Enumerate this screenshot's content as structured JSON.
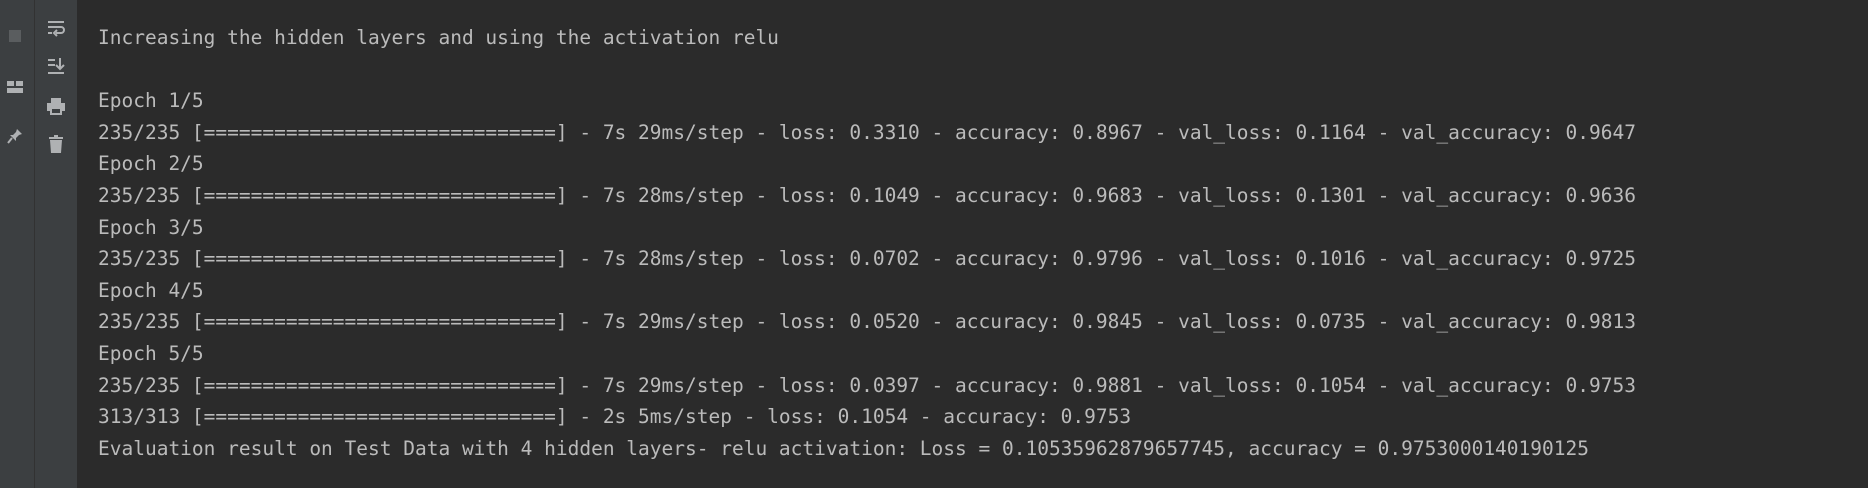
{
  "console": {
    "lines": [
      "Increasing the hidden layers and using the activation relu",
      "",
      "Epoch 1/5",
      "235/235 [==============================] - 7s 29ms/step - loss: 0.3310 - accuracy: 0.8967 - val_loss: 0.1164 - val_accuracy: 0.9647",
      "Epoch 2/5",
      "235/235 [==============================] - 7s 28ms/step - loss: 0.1049 - accuracy: 0.9683 - val_loss: 0.1301 - val_accuracy: 0.9636",
      "Epoch 3/5",
      "235/235 [==============================] - 7s 28ms/step - loss: 0.0702 - accuracy: 0.9796 - val_loss: 0.1016 - val_accuracy: 0.9725",
      "Epoch 4/5",
      "235/235 [==============================] - 7s 29ms/step - loss: 0.0520 - accuracy: 0.9845 - val_loss: 0.0735 - val_accuracy: 0.9813",
      "Epoch 5/5",
      "235/235 [==============================] - 7s 29ms/step - loss: 0.0397 - accuracy: 0.9881 - val_loss: 0.1054 - val_accuracy: 0.9753",
      "313/313 [==============================] - 2s 5ms/step - loss: 0.1054 - accuracy: 0.9753",
      "Evaluation result on Test Data with 4 hidden layers- relu activation: Loss = 0.10535962879657745, accuracy = 0.9753000140190125"
    ]
  },
  "toolbar": {
    "left_icons": [
      "stop-icon",
      "layout-icon",
      "pin-icon"
    ],
    "right_icons": [
      "soft-wrap-icon",
      "scroll-to-end-icon",
      "print-icon",
      "trash-icon"
    ]
  },
  "colors": {
    "background": "#2b2b2b",
    "text": "#bbbbbb",
    "gutter": "#3c3f41"
  }
}
